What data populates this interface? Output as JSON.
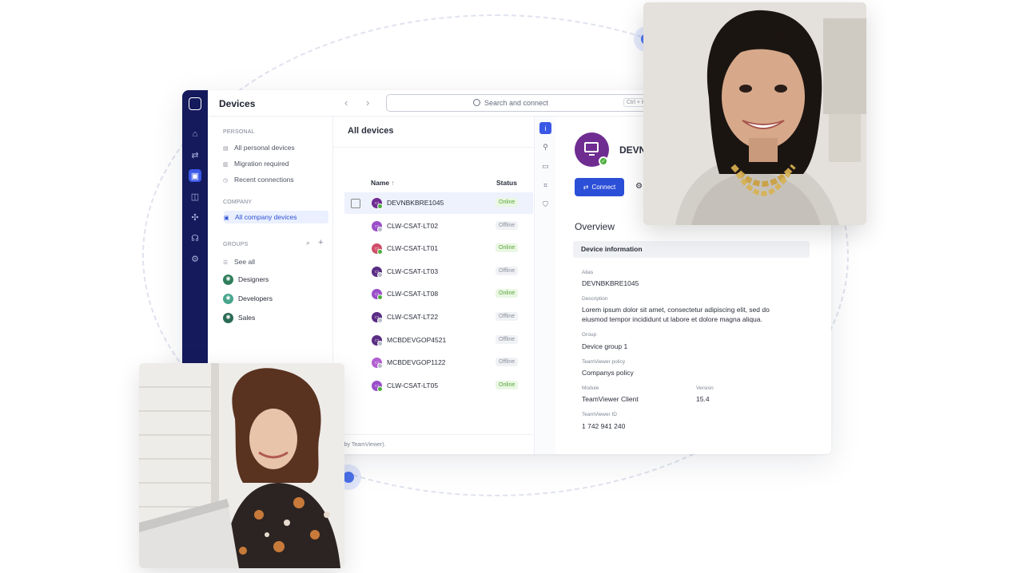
{
  "topbar": {
    "title": "Devices",
    "search_placeholder": "Search and connect",
    "search_shortcut": "Ctrl + K"
  },
  "leftnav": {
    "personal_heading": "PERSONAL",
    "personal_items": [
      "All personal devices",
      "Migration required",
      "Recent connections"
    ],
    "company_heading": "COMPANY",
    "company_item": "All company devices",
    "groups_heading": "GROUPS",
    "see_all": "See all",
    "groups": [
      {
        "label": "Designers",
        "color": "#2f7d5b"
      },
      {
        "label": "Developers",
        "color": "#48a58c"
      },
      {
        "label": "Sales",
        "color": "#2a6b55"
      }
    ]
  },
  "list": {
    "title": "All devices",
    "col_name": "Name",
    "col_name_sort": "↑",
    "col_status": "Status",
    "footnote": "ded by TeamViewer).",
    "devices": [
      {
        "name": "DEVNBKBRE1045",
        "status": "Online",
        "online": true,
        "avatar_color": "#6f2c91"
      },
      {
        "name": "CLW-CSAT-LT02",
        "status": "Offline",
        "online": false,
        "avatar_color": "#9a4fc9"
      },
      {
        "name": "CLW-CSAT-LT01",
        "status": "Online",
        "online": true,
        "avatar_color": "#d04f6a"
      },
      {
        "name": "CLW-CSAT-LT03",
        "status": "Offline",
        "online": false,
        "avatar_color": "#5a2d84"
      },
      {
        "name": "CLW-CSAT-LT08",
        "status": "Online",
        "online": true,
        "avatar_color": "#9a4fc9"
      },
      {
        "name": "CLW-CSAT-LT22",
        "status": "Offline",
        "online": false,
        "avatar_color": "#5a2d84"
      },
      {
        "name": "MCBDEVGOP4521",
        "status": "Offline",
        "online": false,
        "avatar_color": "#5a2d84"
      },
      {
        "name": "MCBDEVGOP1122",
        "status": "Offline",
        "online": false,
        "avatar_color": "#b15fd0"
      },
      {
        "name": "CLW-CSAT-LT05",
        "status": "Online",
        "online": true,
        "avatar_color": "#9a4fc9"
      }
    ]
  },
  "detail": {
    "device_name_partial": "DEVN",
    "connect_label": "Connect",
    "overview": "Overview",
    "info_heading": "Device information",
    "alias_label": "Alias",
    "alias": "DEVNBKBRE1045",
    "description_label": "Description",
    "description": "Lorem ipsum dolor sit amet, consectetur adipiscing elit, sed do eiusmod tempor incididunt ut labore et dolore magna aliqua.",
    "group_label": "Group",
    "group": "Device group 1",
    "policy_label": "TeamViewer policy",
    "policy": "Companys policy",
    "module_label": "Module",
    "module": "TeamViewer Client",
    "version_label": "Version",
    "version": "15.4",
    "id_label": "TeamViewer ID",
    "id": "1 742 941 240"
  },
  "colors": {
    "accent": "#2c4fd8",
    "rail": "#141a5c",
    "online": "#58a53b"
  }
}
